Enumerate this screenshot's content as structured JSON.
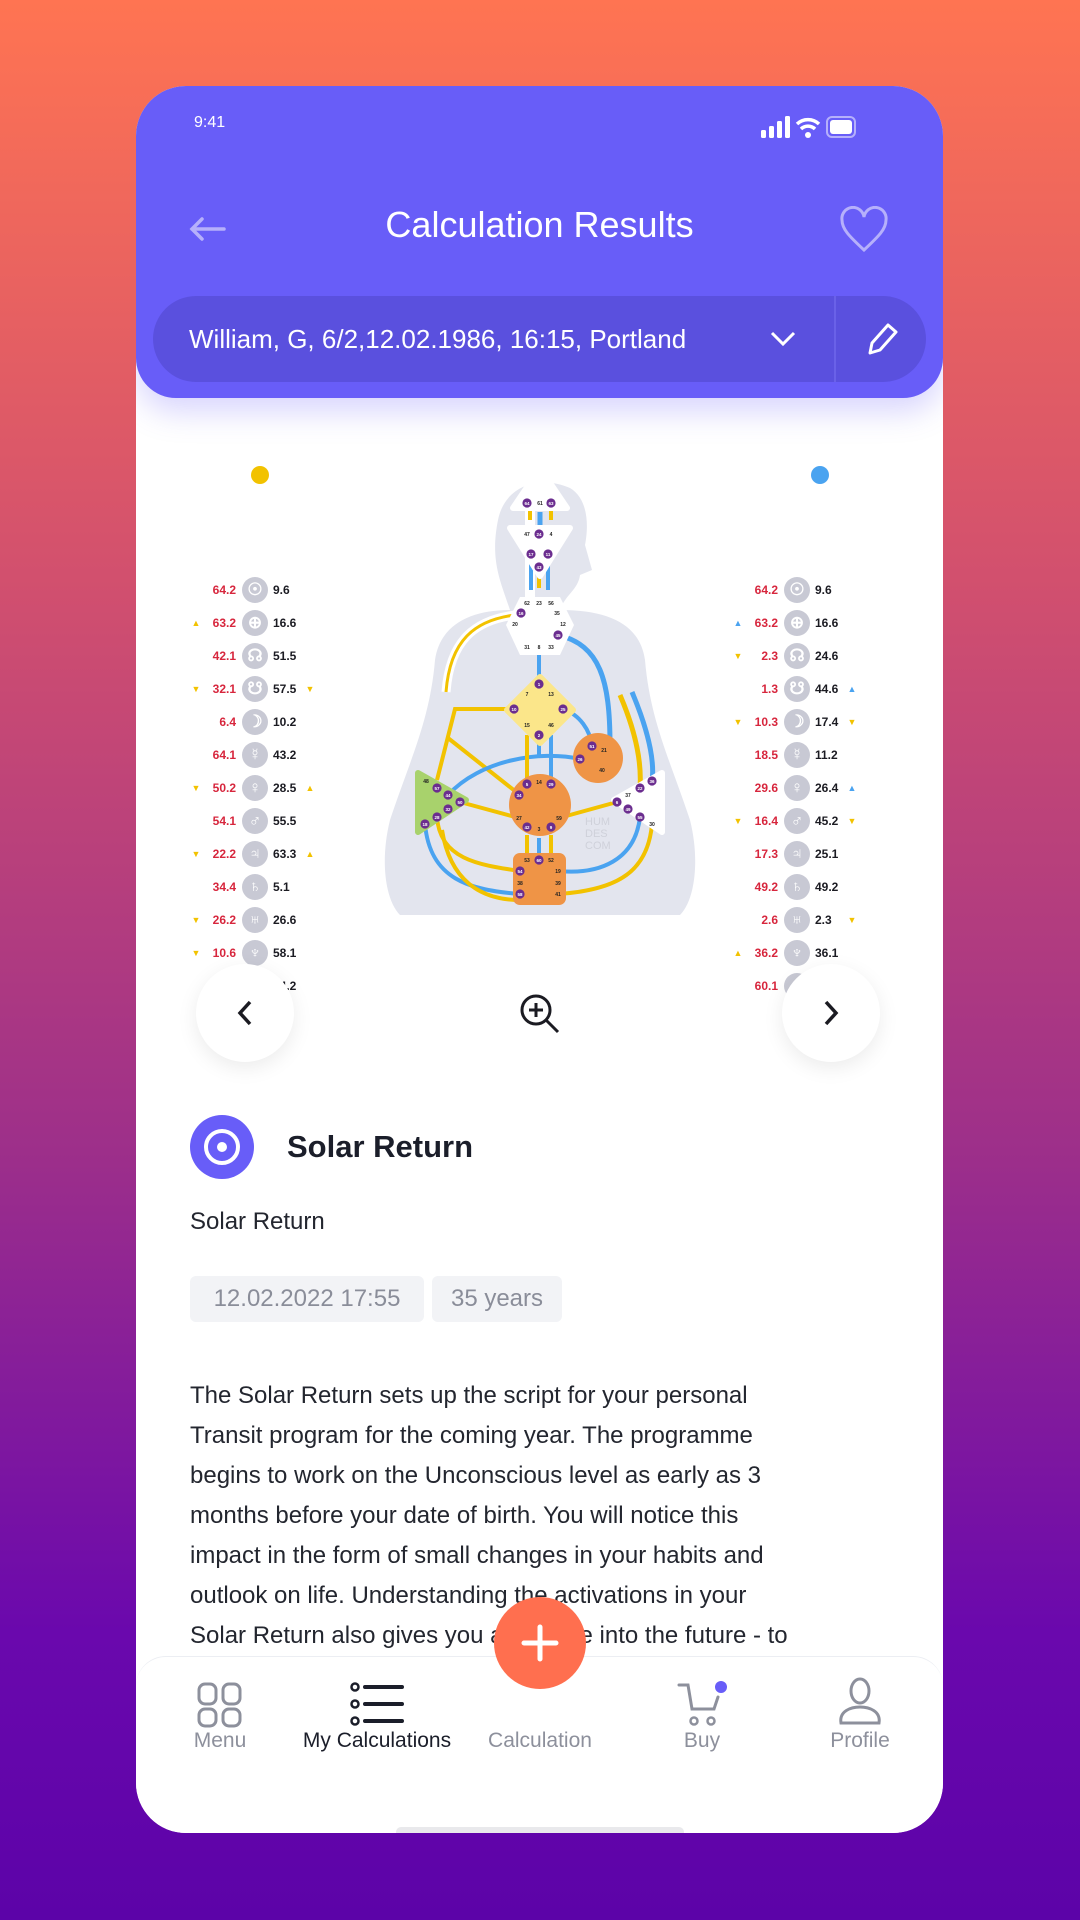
{
  "status_bar": {
    "time": "9:41"
  },
  "header": {
    "title": "Calculation Results",
    "back_icon": "arrow-left-icon",
    "favorite_icon": "heart-icon"
  },
  "selector": {
    "value": "William, G, 6/2,12.02.1986, 16:15, Portland",
    "dropdown_icon": "chevron-down-icon",
    "edit_icon": "pencil-icon"
  },
  "chart": {
    "colors": {
      "personality": "#f2c200",
      "design": "#4aa3f0",
      "values": "#d7263d",
      "gate": "#6b2d8f"
    },
    "planets": [
      "☉",
      "⊕",
      "☊",
      "☋",
      "☽",
      "☿",
      "♀",
      "♂",
      "♃",
      "♄",
      "♅",
      "♆",
      "♇"
    ],
    "left": [
      {
        "red": "64.2",
        "black": "9.6"
      },
      {
        "red": "63.2",
        "red_arrow": "up",
        "black": "16.6"
      },
      {
        "red": "42.1",
        "black": "51.5"
      },
      {
        "red": "32.1",
        "red_arrow": "down",
        "black": "57.5",
        "black_arrow": "down"
      },
      {
        "red": "6.4",
        "black": "10.2"
      },
      {
        "red": "64.1",
        "black": "43.2"
      },
      {
        "red": "50.2",
        "red_arrow": "down",
        "black": "28.5",
        "black_arrow": "up"
      },
      {
        "red": "54.1",
        "black": "55.5"
      },
      {
        "red": "22.2",
        "red_arrow": "down",
        "black": "63.3",
        "black_arrow": "up"
      },
      {
        "red": "34.4",
        "black": "5.1"
      },
      {
        "red": "26.2",
        "red_arrow": "down",
        "black": "26.6"
      },
      {
        "red": "10.6",
        "red_arrow": "down",
        "black": "58.1"
      },
      {
        "red": "28.4",
        "black": "44.2"
      }
    ],
    "right": [
      {
        "red": "64.2",
        "black": "9.6"
      },
      {
        "red": "63.2",
        "red_arrow": "up-blue",
        "black": "16.6"
      },
      {
        "red": "2.3",
        "red_arrow": "down",
        "black": "24.6"
      },
      {
        "red": "1.3",
        "black": "44.6",
        "black_arrow": "up-blue"
      },
      {
        "red": "10.3",
        "red_arrow": "down",
        "black": "17.4",
        "black_arrow": "down"
      },
      {
        "red": "18.5",
        "black": "11.2"
      },
      {
        "red": "29.6",
        "black": "26.4",
        "black_arrow": "up-blue"
      },
      {
        "red": "16.4",
        "red_arrow": "down",
        "black": "45.2",
        "black_arrow": "down"
      },
      {
        "red": "17.3",
        "black": "25.1"
      },
      {
        "red": "49.2",
        "black": "49.2"
      },
      {
        "red": "2.6",
        "black": "2.3",
        "black_arrow": "down"
      },
      {
        "red": "36.2",
        "red_arrow": "up",
        "black": "36.1"
      },
      {
        "red": "60.1",
        "black": "60.1"
      }
    ],
    "gates": [
      "64",
      "61",
      "63",
      "47",
      "24",
      "4",
      "17",
      "11",
      "43",
      "62",
      "23",
      "56",
      "16",
      "35",
      "20",
      "12",
      "45",
      "31",
      "8",
      "33",
      "1",
      "7",
      "13",
      "10",
      "25",
      "15",
      "46",
      "2",
      "51",
      "21",
      "26",
      "40",
      "5",
      "14",
      "29",
      "34",
      "27",
      "59",
      "42",
      "3",
      "9",
      "48",
      "57",
      "44",
      "50",
      "32",
      "28",
      "18",
      "36",
      "22",
      "37",
      "6",
      "49",
      "55",
      "30",
      "53",
      "60",
      "52",
      "54",
      "19",
      "38",
      "39",
      "58",
      "41"
    ],
    "active_gates": [
      "64",
      "63",
      "24",
      "17",
      "11",
      "43",
      "16",
      "45",
      "1",
      "10",
      "25",
      "2",
      "51",
      "26",
      "5",
      "29",
      "34",
      "42",
      "9",
      "57",
      "44",
      "50",
      "32",
      "28",
      "18",
      "36",
      "22",
      "6",
      "49",
      "55",
      "60",
      "54",
      "58"
    ],
    "watermark": "HUM DES COM"
  },
  "controls": {
    "prev_icon": "chevron-left-icon",
    "zoom_icon": "zoom-in-icon",
    "next_icon": "chevron-right-icon"
  },
  "section": {
    "title": "Solar Return",
    "subtitle": "Solar Return",
    "date": "12.02.2022 17:55",
    "age": "35 years",
    "description": [
      "The Solar Return sets up the script for your personal",
      "Transit program for the coming year. The programme",
      "begins to work on the Unconscious level as early as 3",
      "months before your date of birth. You will notice this",
      "impact in the form of small changes in your habits and",
      "outlook on life. Understanding the activations in your",
      "Solar Return also gives you a glimpse into the future - to"
    ]
  },
  "nav": {
    "items": [
      {
        "label": "Menu",
        "icon": "grid-icon"
      },
      {
        "label": "My Calculations",
        "icon": "list-icon",
        "active": true
      },
      {
        "label": "Calculation",
        "icon": "plus-icon"
      },
      {
        "label": "Buy",
        "icon": "cart-icon"
      },
      {
        "label": "Profile",
        "icon": "user-icon"
      }
    ],
    "accent": "#ff6f4f"
  }
}
